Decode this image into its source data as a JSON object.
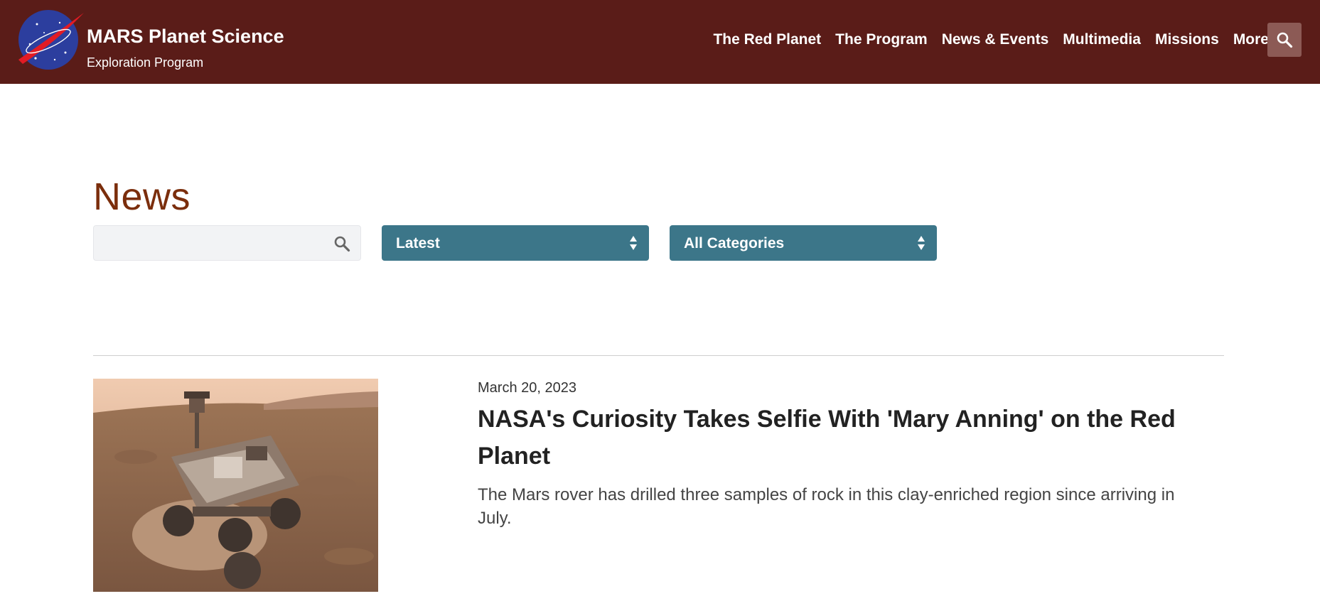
{
  "header": {
    "brand_title": "MARS Planet Science",
    "brand_subtitle": "Exploration Program",
    "logo_icon": "nasa-meatball-logo",
    "nav": [
      {
        "label": "The Red Planet"
      },
      {
        "label": "The Program"
      },
      {
        "label": "News & Events"
      },
      {
        "label": "Multimedia"
      },
      {
        "label": "Missions"
      },
      {
        "label": "More"
      }
    ],
    "search_icon": "search-icon",
    "colors": {
      "bar": "#5a1c18",
      "search_button": "#8c5a55"
    }
  },
  "page": {
    "title": "News",
    "title_color": "#7b2e0c"
  },
  "filters": {
    "search": {
      "value": "",
      "placeholder": ""
    },
    "sort": {
      "selected": "Latest"
    },
    "category": {
      "selected": "All Categories"
    },
    "select_color": "#3c7689"
  },
  "articles": [
    {
      "date": "March 20, 2023",
      "title": "NASA's Curiosity Takes Selfie With 'Mary Anning' on the Red Planet",
      "teaser": "The Mars rover has drilled three samples of rock in this clay-enriched region since arriving in July."
    }
  ]
}
